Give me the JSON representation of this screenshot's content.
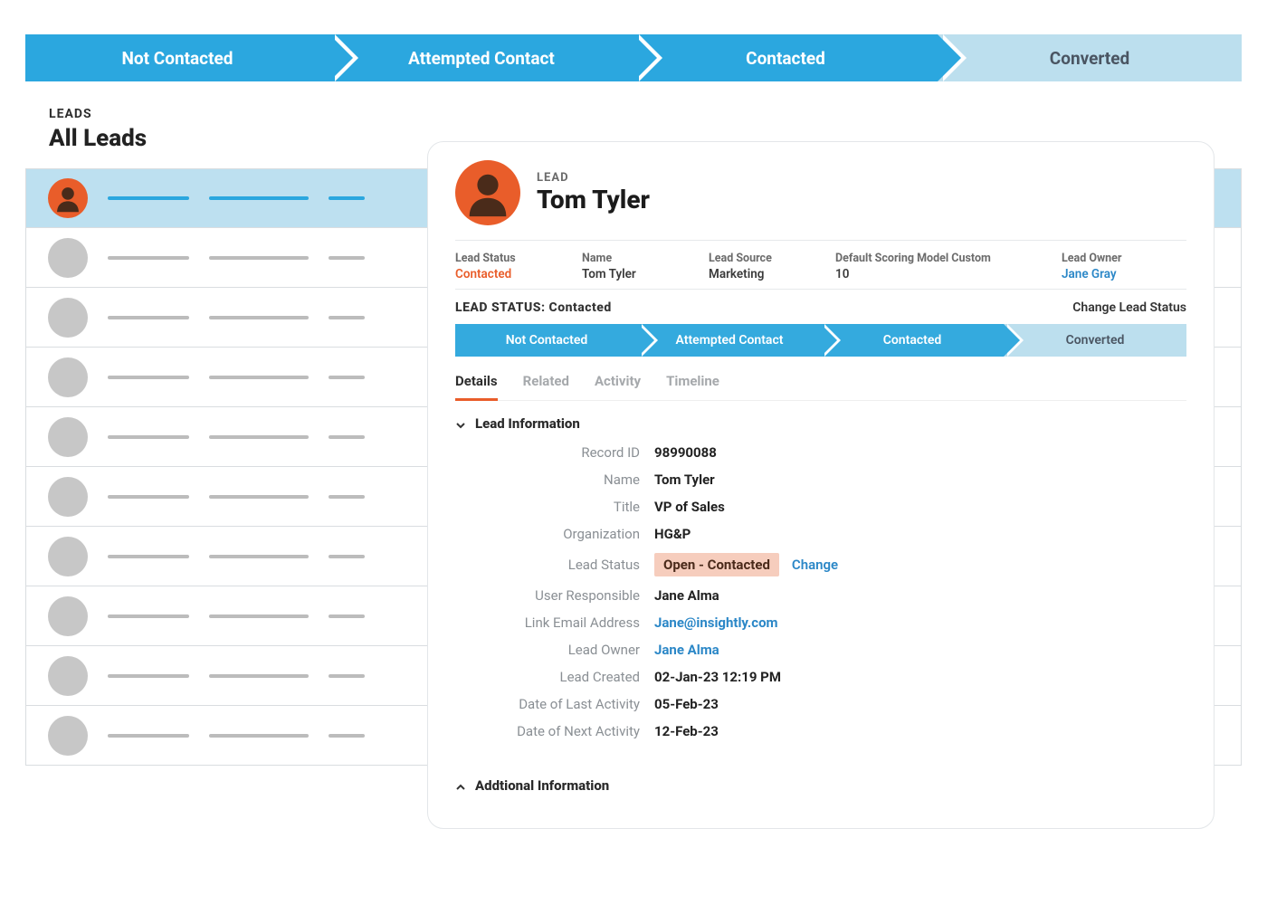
{
  "pipeline": {
    "stages": [
      {
        "label": "Not Contacted",
        "active": true
      },
      {
        "label": "Attempted Contact",
        "active": true
      },
      {
        "label": "Contacted",
        "active": true
      },
      {
        "label": "Converted",
        "active": false
      }
    ]
  },
  "leads_panel": {
    "eyebrow": "LEADS",
    "title": "All Leads"
  },
  "lead": {
    "eyebrow": "LEAD",
    "name": "Tom Tyler",
    "summary": {
      "lead_status_label": "Lead Status",
      "lead_status_value": "Contacted",
      "name_label": "Name",
      "name_value": "Tom Tyler",
      "source_label": "Lead Source",
      "source_value": "Marketing",
      "score_label": "Default Scoring Model Custom",
      "score_value": "10",
      "owner_label": "Lead Owner",
      "owner_value": "Jane Gray"
    },
    "status_bar": {
      "label": "LEAD STATUS: Contacted",
      "action": "Change Lead Status"
    },
    "mini_pipeline": [
      {
        "label": "Not Contacted",
        "active": true
      },
      {
        "label": "Attempted Contact",
        "active": true
      },
      {
        "label": "Contacted",
        "active": true
      },
      {
        "label": "Converted",
        "active": false
      }
    ],
    "tabs": [
      {
        "label": "Details",
        "active": true
      },
      {
        "label": "Related",
        "active": false
      },
      {
        "label": "Activity",
        "active": false
      },
      {
        "label": "Timeline",
        "active": false
      }
    ],
    "sections": {
      "lead_info_title": "Lead Information",
      "additional_info_title": "Addtional Information"
    },
    "fields": {
      "record_id": {
        "label": "Record ID",
        "value": "98990088"
      },
      "name": {
        "label": "Name",
        "value": "Tom Tyler"
      },
      "title": {
        "label": "Title",
        "value": "VP of Sales"
      },
      "organization": {
        "label": "Organization",
        "value": "HG&P"
      },
      "lead_status": {
        "label": "Lead Status",
        "value": "Open - Contacted",
        "change": "Change"
      },
      "user_responsible": {
        "label": "User Responsible",
        "value": "Jane Alma"
      },
      "link_email": {
        "label": "Link Email Address",
        "value": "Jane@insightly.com"
      },
      "lead_owner": {
        "label": "Lead Owner",
        "value": "Jane Alma"
      },
      "lead_created": {
        "label": "Lead Created",
        "value": "02-Jan-23 12:19 PM"
      },
      "last_activity": {
        "label": "Date of Last Activity",
        "value": "05-Feb-23"
      },
      "next_activity": {
        "label": "Date of Next Activity",
        "value": "12-Feb-23"
      }
    }
  }
}
